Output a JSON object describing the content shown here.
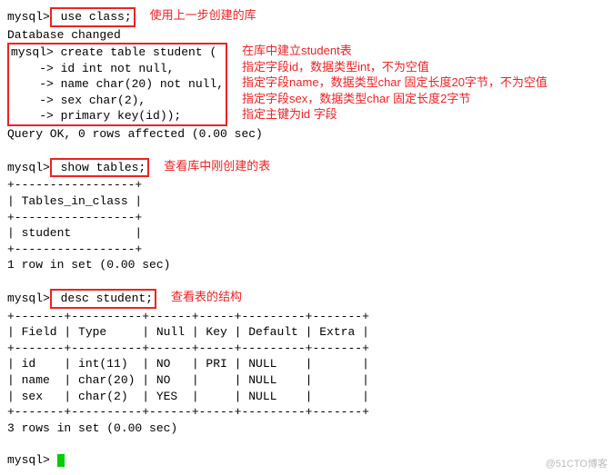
{
  "prompt": "mysql>",
  "cont": "    ->",
  "cmds": {
    "use_label": " use class;",
    "db_changed": "Database changed",
    "create1": " create table student (",
    "create2": " id int not null,",
    "create3": " name char(20) not null,",
    "create4": " sex char(2),",
    "create5": " primary key(id));",
    "query_ok": "Query OK, 0 rows affected (0.00 sec)",
    "show_tables": " show tables;",
    "desc_student": " desc student;",
    "rows1": "1 row in set (0.00 sec)",
    "rows3": "3 rows in set (0.00 sec)"
  },
  "annotations": {
    "use": "使用上一步创建的库",
    "create_title": "在库中建立student表",
    "create_a": "指定字段id，数据类型int，不为空值",
    "create_b": "指定字段name，数据类型char 固定长度20字节，不为空值",
    "create_c": "指定字段sex，数据类型char 固定长度2字节",
    "create_d": "指定主键为id 字段",
    "show": "查看库中刚创建的表",
    "desc": "查看表的结构"
  },
  "tables": {
    "sep1": "+-----------------+",
    "hdr1": "| Tables_in_class |",
    "row1": "| student         |",
    "descsep": "+-------+----------+------+-----+---------+-------+",
    "deschdr": "| Field | Type     | Null | Key | Default | Extra |",
    "descr1": "| id    | int(11)  | NO   | PRI | NULL    |       |",
    "descr2": "| name  | char(20) | NO   |     | NULL    |       |",
    "descr3": "| sex   | char(2)  | YES  |     | NULL    |       |"
  },
  "chart_data": {
    "type": "table",
    "title": "desc student;",
    "columns": [
      "Field",
      "Type",
      "Null",
      "Key",
      "Default",
      "Extra"
    ],
    "rows": [
      {
        "Field": "id",
        "Type": "int(11)",
        "Null": "NO",
        "Key": "PRI",
        "Default": "NULL",
        "Extra": ""
      },
      {
        "Field": "name",
        "Type": "char(20)",
        "Null": "NO",
        "Key": "",
        "Default": "NULL",
        "Extra": ""
      },
      {
        "Field": "sex",
        "Type": "char(2)",
        "Null": "YES",
        "Key": "",
        "Default": "NULL",
        "Extra": ""
      }
    ]
  },
  "watermark": "@51CTO博客"
}
